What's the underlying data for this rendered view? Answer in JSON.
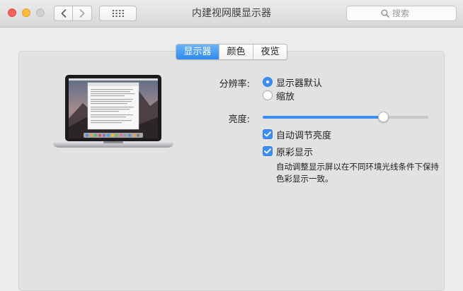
{
  "window": {
    "title": "内建视网膜显示器"
  },
  "toolbar": {
    "back_icon": "chevron-left-icon",
    "forward_icon": "chevron-right-icon",
    "grid_icon": "grid-icon"
  },
  "search": {
    "placeholder": "搜索",
    "value": ""
  },
  "tabs": [
    {
      "label": "显示器",
      "active": true
    },
    {
      "label": "颜色",
      "active": false
    },
    {
      "label": "夜览",
      "active": false
    }
  ],
  "resolution": {
    "label": "分辨率:",
    "options": [
      {
        "label": "显示器默认",
        "selected": true
      },
      {
        "label": "缩放",
        "selected": false
      }
    ]
  },
  "brightness": {
    "label": "亮度:",
    "value": 0.73
  },
  "auto_brightness": {
    "label": "自动调节亮度",
    "checked": true
  },
  "true_tone": {
    "label": "原彩显示",
    "checked": true,
    "description_line1": "自动调整显示屏以在不同环境光线条件下保持",
    "description_line2": "色彩显示一致。"
  },
  "colors": {
    "accent": "#3d8ff5",
    "panel": "#e2e2e2",
    "window": "#ececec"
  }
}
